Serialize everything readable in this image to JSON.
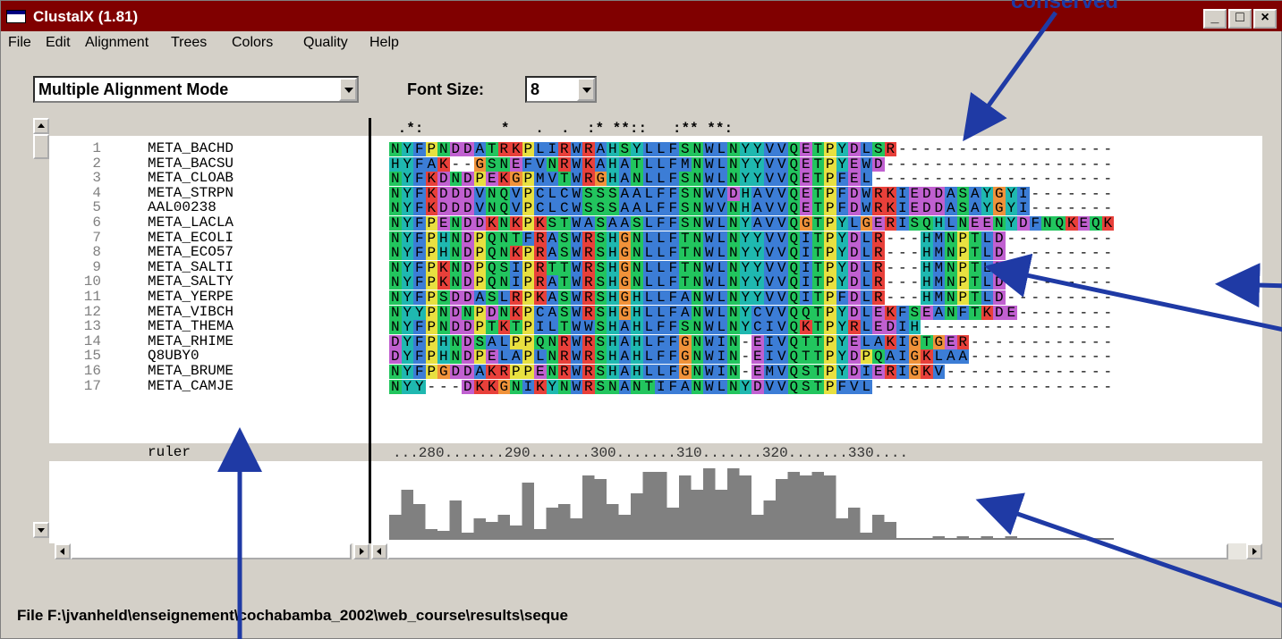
{
  "window": {
    "title": "ClustalX (1.81)",
    "minimize": "_",
    "maximize": "□",
    "close": "×"
  },
  "menu": [
    "File",
    "Edit",
    "Alignment",
    "Trees",
    "Colors",
    "Quality",
    "Help"
  ],
  "toolbar": {
    "mode_value": "Multiple Alignment Mode",
    "font_size_label": "Font Size:",
    "font_size_value": "8"
  },
  "callout": {
    "top_label": "conserved"
  },
  "conservation_line": " .*:         *   .  .  :* **::   :** **:",
  "sequences": [
    {
      "num": "1",
      "name": "META_BACHD",
      "seq": "NYFPNDDATRKPLIRWRAHSYLLFSNWLNYYVVQETPYDLSR------------------"
    },
    {
      "num": "2",
      "name": "META_BACSU",
      "seq": "HYFAK--GSNEFVNRWKAHATLLFMNWLNYYVVQETPYEWD-------------------"
    },
    {
      "num": "3",
      "name": "META_CLOAB",
      "seq": "NYFKDNDPEKGPMVTWRGHANLLFSNWLNYYVVQETPFEL--------------------"
    },
    {
      "num": "4",
      "name": "META_STRPN",
      "seq": "NYFKDDDVNQVPCLCWSSSAALFFSNWVDHAVVQETPFDWRKIEDDASAYGYI-------"
    },
    {
      "num": "5",
      "name": "AAL00238",
      "seq": "NYFKDDDVNQVPCLCWSSSAALFFSNWVNHAVVQETPFDWRKIEDDASAYGYI-------"
    },
    {
      "num": "6",
      "name": "META_LACLA",
      "seq": "NYFPENDDKNKPKSTWASAASLFFSNWLNYAVVQGTPYLGERISQHLNEENYDFNQKEQK"
    },
    {
      "num": "7",
      "name": "META_ECOLI",
      "seq": "NYFPHNDPQNTFRASWRSHGNLLFTNWLNYYVVQITPYDLR---HMNPTLD---------"
    },
    {
      "num": "8",
      "name": "META_ECO57",
      "seq": "NYFPHNDPQNKPRASWRSHGNLLFTNWLNYYVVQITPYDLR---HMNPTLD---------"
    },
    {
      "num": "9",
      "name": "META_SALTI",
      "seq": "NYFPKNDPQSIPRTTWRSHGNLLFTNWLNYYVVQITPYDLR---HMNPTLD---------"
    },
    {
      "num": "10",
      "name": "META_SALTY",
      "seq": "NYFPKNDPQNIPRATWRSHGNLLFTNWLNYYVVQITPYDLR---HMNPTLD---------"
    },
    {
      "num": "11",
      "name": "META_YERPE",
      "seq": "NYFPSDDASLRPKASWRSHGHLLFANWLNYYVVQITPFDLR---HMNPTLD---------"
    },
    {
      "num": "12",
      "name": "META_VIBCH",
      "seq": "NYYPNDNPDNKPCASWRSHGHLLFANWLNYCVVQQTPYDLEKFSEANFTKDE--------"
    },
    {
      "num": "13",
      "name": "META_THEMA",
      "seq": "NYFPNDDPTKTPILTWWSHAHLFFSNWLNYCIVQKTPYRLEDIH----------------"
    },
    {
      "num": "14",
      "name": "META_RHIME",
      "seq": "DYFPHNDSALPPQNRWRSHAHLFFGNWIN-EIVQTTPYELAKIGTGER------------"
    },
    {
      "num": "15",
      "name": "Q8UBY0",
      "seq": "DYFPHNDPELAPLNRWRSHAHLFFGNWIN-EIVQTTPYDPQAIGKLAA------------"
    },
    {
      "num": "16",
      "name": "META_BRUME",
      "seq": "NYFPGDDAKRPPENRWRSHAHLLFGNWIN-EMVQSTPYDIERIGKV--------------"
    },
    {
      "num": "17",
      "name": "META_CAMJE",
      "seq": "NYY---DKKGNIKYNWRSNANTIFANWLNYDVVQSTPFVL--------------------"
    }
  ],
  "ruler": {
    "label": "ruler",
    "text": "...280.......290.......300.......310.......320.......330...."
  },
  "quality_histogram": [
    14,
    28,
    20,
    6,
    5,
    22,
    4,
    12,
    10,
    14,
    8,
    32,
    6,
    18,
    20,
    12,
    36,
    34,
    20,
    14,
    26,
    38,
    38,
    18,
    36,
    28,
    40,
    28,
    40,
    36,
    14,
    22,
    34,
    38,
    36,
    38,
    36,
    12,
    18,
    4,
    14,
    10,
    1,
    1,
    1,
    2,
    1,
    2,
    1,
    2,
    1,
    2,
    1,
    1,
    1,
    1,
    1,
    1,
    1,
    1
  ],
  "status": "File F:\\jvanheld\\enseignement\\cochabamba_2002\\web_course\\results\\seque",
  "colors": {
    "titlebar": "#800000",
    "callout": "#1f3aa5",
    "histogram": "#808080"
  }
}
